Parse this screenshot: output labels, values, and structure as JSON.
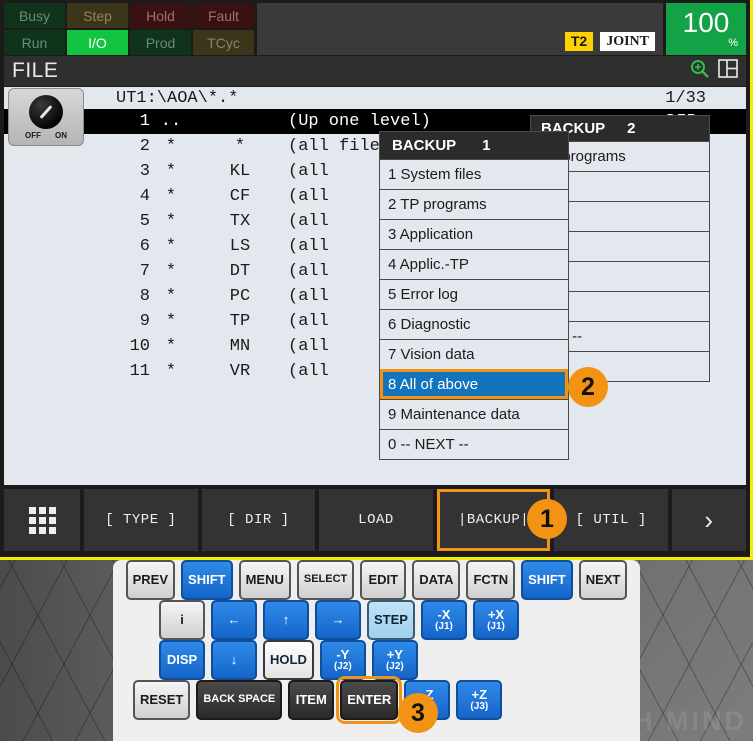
{
  "status": {
    "lamps": [
      {
        "label": "Busy",
        "state": "green-off"
      },
      {
        "label": "Step",
        "state": "olive-off"
      },
      {
        "label": "Hold",
        "state": "red-off"
      },
      {
        "label": "Fault",
        "state": "red-off"
      },
      {
        "label": "Run",
        "state": "green-off"
      },
      {
        "label": "I/O",
        "state": "green-on"
      },
      {
        "label": "Prod",
        "state": "green-off"
      },
      {
        "label": "TCyc",
        "state": "olive-off"
      }
    ],
    "t2_badge": "T2",
    "mode_badge": "JOINT",
    "override_value": "100",
    "override_unit": "%",
    "accent_yellow": "#ffd100",
    "accent_green": "#12a346"
  },
  "titlebar": {
    "title": "FILE",
    "zoom_icon": "zoom-in-icon",
    "layout_icon": "split-panel-icon"
  },
  "content": {
    "path": "UT1:\\AOA\\*.*",
    "page_indicator": "1/33",
    "columns": [
      "num",
      "star",
      "name",
      "desc",
      "type"
    ],
    "rows": [
      {
        "num": "1",
        "star": "..",
        "name": "",
        "desc": "(Up one level)",
        "type": "<DIR>",
        "selected": true
      },
      {
        "num": "2",
        "star": "*",
        "name": "*",
        "desc": "(all files)",
        "type": "",
        "selected": false
      },
      {
        "num": "3",
        "star": "*",
        "name": "KL",
        "desc": "(all",
        "type": "",
        "selected": false
      },
      {
        "num": "4",
        "star": "*",
        "name": "CF",
        "desc": "(all",
        "type": "",
        "selected": false
      },
      {
        "num": "5",
        "star": "*",
        "name": "TX",
        "desc": "(all",
        "type": "",
        "selected": false
      },
      {
        "num": "6",
        "star": "*",
        "name": "LS",
        "desc": "(all",
        "type": "",
        "selected": false
      },
      {
        "num": "7",
        "star": "*",
        "name": "DT",
        "desc": "(all",
        "type": "",
        "selected": false
      },
      {
        "num": "8",
        "star": "*",
        "name": "PC",
        "desc": "(all",
        "type": "",
        "selected": false
      },
      {
        "num": "9",
        "star": "*",
        "name": "TP",
        "desc": "(all",
        "type": "",
        "selected": false
      },
      {
        "num": "10",
        "star": "*",
        "name": "MN",
        "desc": "(all",
        "type": "",
        "selected": false
      },
      {
        "num": "11",
        "star": "*",
        "name": "VR",
        "desc": "(all",
        "type": "",
        "selected": false
      }
    ]
  },
  "backup_panel_2": {
    "head_title": "BACKUP",
    "head_page": "2",
    "rows": [
      {
        "label": "CII programs"
      },
      {
        "label": ""
      },
      {
        "label": ""
      },
      {
        "label": ""
      },
      {
        "label": ""
      },
      {
        "label": ""
      },
      {
        "label": "EXT --"
      },
      {
        "label": ""
      }
    ]
  },
  "backup_panel_1": {
    "head_title": "BACKUP",
    "head_page": "1",
    "items": [
      {
        "label": "1 System files",
        "active": false
      },
      {
        "label": "2 TP programs",
        "active": false
      },
      {
        "label": "3 Application",
        "active": false
      },
      {
        "label": "4 Applic.-TP",
        "active": false
      },
      {
        "label": "5 Error log",
        "active": false
      },
      {
        "label": "6 Diagnostic",
        "active": false
      },
      {
        "label": "7 Vision data",
        "active": false
      },
      {
        "label": "8 All of above",
        "active": true
      },
      {
        "label": "9 Maintenance data",
        "active": false
      },
      {
        "label": "0 -- NEXT --",
        "active": false
      }
    ],
    "highlight_color": "#1274bd",
    "focus_color": "#f39314"
  },
  "softkeys": [
    {
      "label": "",
      "icon": "grid-menu-icon",
      "kind": "icon",
      "active": false
    },
    {
      "label": "[ TYPE ]",
      "icon": "",
      "kind": "text",
      "active": false
    },
    {
      "label": "[ DIR ]",
      "icon": "",
      "kind": "text",
      "active": false
    },
    {
      "label": "LOAD",
      "icon": "",
      "kind": "text",
      "active": false
    },
    {
      "label": "|BACKUP|",
      "icon": "",
      "kind": "text",
      "active": true
    },
    {
      "label": "[ UTIL ]",
      "icon": "",
      "kind": "text",
      "active": false
    },
    {
      "label": "›",
      "icon": "chevron-right-icon",
      "kind": "arrow",
      "active": false
    }
  ],
  "keypad": {
    "row1": [
      {
        "label": "PREV",
        "style": "grey",
        "sub": ""
      },
      {
        "label": "SHIFT",
        "style": "blue",
        "sub": ""
      },
      {
        "label": "MENU",
        "style": "grey",
        "sub": ""
      },
      {
        "label": "SELECT",
        "style": "grey",
        "sub": ""
      },
      {
        "label": "EDIT",
        "style": "grey",
        "sub": ""
      },
      {
        "label": "DATA",
        "style": "grey",
        "sub": ""
      },
      {
        "label": "FCTN",
        "style": "grey",
        "sub": ""
      },
      {
        "label": "SHIFT",
        "style": "blue",
        "sub": ""
      },
      {
        "label": "NEXT",
        "style": "grey",
        "sub": ""
      }
    ],
    "row2": [
      {
        "label": "i",
        "style": "grey",
        "sub": "",
        "name": "info-key"
      },
      {
        "label": "←",
        "style": "blue",
        "sub": "",
        "name": "arrow-left-key"
      },
      {
        "label": "↑",
        "style": "blue",
        "sub": "",
        "name": "arrow-up-key"
      },
      {
        "label": "→",
        "style": "blue",
        "sub": "",
        "name": "arrow-right-key"
      },
      {
        "label": "STEP",
        "style": "cyan",
        "sub": "",
        "name": "step-key"
      },
      {
        "label": "-X",
        "style": "blue",
        "sub": "(J1)",
        "name": "jog-minus-x-key"
      },
      {
        "label": "+X",
        "style": "blue",
        "sub": "(J1)",
        "name": "jog-plus-x-key"
      }
    ],
    "row3": [
      {
        "label": "DISP",
        "style": "blue",
        "sub": "",
        "name": "disp-key"
      },
      {
        "label": "↓",
        "style": "blue",
        "sub": "",
        "name": "arrow-down-key"
      },
      {
        "label": "HOLD",
        "style": "white",
        "sub": "",
        "name": "hold-key"
      },
      {
        "label": "-Y",
        "style": "blue",
        "sub": "(J2)",
        "name": "jog-minus-y-key"
      },
      {
        "label": "+Y",
        "style": "blue",
        "sub": "(J2)",
        "name": "jog-plus-y-key"
      }
    ],
    "row4": [
      {
        "label": "RESET",
        "style": "grey",
        "sub": "",
        "active": false,
        "name": "reset-key"
      },
      {
        "label": "BACK SPACE",
        "style": "dark",
        "sub": "",
        "active": false,
        "name": "backspace-key"
      },
      {
        "label": "ITEM",
        "style": "dark",
        "sub": "",
        "active": false,
        "name": "item-key"
      },
      {
        "label": "ENTER",
        "style": "dark",
        "sub": "",
        "active": true,
        "name": "enter-key"
      },
      {
        "label": "-Z",
        "style": "blue",
        "sub": "(J3)",
        "active": false,
        "name": "jog-minus-z-key"
      },
      {
        "label": "+Z",
        "style": "blue",
        "sub": "(J3)",
        "active": false,
        "name": "jog-plus-z-key"
      }
    ],
    "knob": {
      "off_label": "OFF",
      "on_label": "ON"
    }
  },
  "badges": {
    "one": "1",
    "two": "2",
    "three": "3",
    "color": "#f39314"
  },
  "watermark": "MECH MIND"
}
